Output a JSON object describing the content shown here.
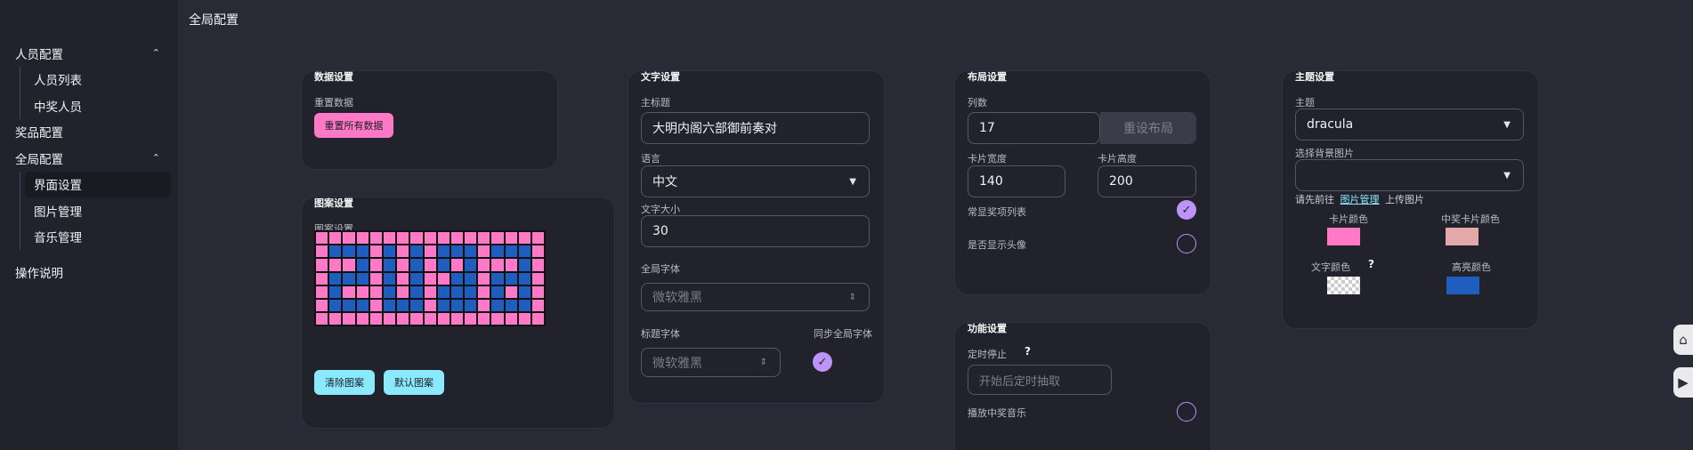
{
  "page_title": "全局配置",
  "sidebar": {
    "groups": [
      {
        "label": "人员配置",
        "chevron": "⌃",
        "items": [
          "人员列表",
          "中奖人员"
        ]
      },
      {
        "label": "奖品配置"
      },
      {
        "label": "全局配置",
        "chevron": "⌃",
        "items": [
          "界面设置",
          "图片管理",
          "音乐管理"
        ]
      },
      {
        "label": "操作说明"
      }
    ]
  },
  "data_settings": {
    "title": "数据设置",
    "reset_label": "重置数据",
    "reset_button": "重置所有数据"
  },
  "pattern_settings": {
    "title": "图案设置",
    "label": "图案设置",
    "clear_button": "清除图案",
    "default_button": "默认图案",
    "grid": [
      "ppppppppppppppppp",
      "pbbbpbpbpbbbpbbbp",
      "pppbpbpbpbpbpppbp",
      "pbbbpbpbppbbpbbbp",
      "pbpppbpbpbbbpbpbp",
      "pbbbpbbbpbbbpbbbp",
      "ppppppppppppppppp"
    ]
  },
  "text_settings": {
    "title": "文字设置",
    "main_title_label": "主标题",
    "main_title_value": "大明内阁六部御前奏对",
    "language_label": "语言",
    "language_value": "中文",
    "font_size_label": "文字大小",
    "font_size_value": "30",
    "global_font_label": "全局字体",
    "global_font_placeholder": "微软雅黑",
    "title_font_label": "标题字体",
    "title_font_placeholder": "微软雅黑",
    "sync_label": "同步全局字体",
    "sync_checked": true
  },
  "layout_settings": {
    "title": "布局设置",
    "columns_label": "列数",
    "columns_value": "17",
    "reset_layout_button": "重设布局",
    "card_width_label": "卡片宽度",
    "card_width_value": "140",
    "card_height_label": "卡片高度",
    "card_height_value": "200",
    "show_prize_list_label": "常显奖项列表",
    "show_prize_list": true,
    "show_avatar_label": "是否显示头像",
    "show_avatar": false
  },
  "function_settings": {
    "title": "功能设置",
    "timer_label": "定时停止",
    "help_mark": "?",
    "timer_placeholder": "开始后定时抽取",
    "music_label": "播放中奖音乐",
    "music": false
  },
  "theme_settings": {
    "title": "主题设置",
    "theme_label": "主题",
    "theme_value": "dracula",
    "bg_label": "选择背景图片",
    "bg_hint_prefix": "请先前往",
    "bg_hint_link": "图片管理",
    "bg_hint_suffix": "上传图片",
    "card_color_label": "卡片颜色",
    "card_color": "#ff79c6",
    "winner_card_color_label": "中奖卡片颜色",
    "winner_card_color": "#e5a8a8",
    "text_color_label": "文字颜色",
    "help_mark": "?",
    "highlight_color_label": "高亮颜色",
    "highlight_color": "#1f5dbf"
  },
  "float_buttons": [
    "home-icon",
    "play-icon"
  ]
}
